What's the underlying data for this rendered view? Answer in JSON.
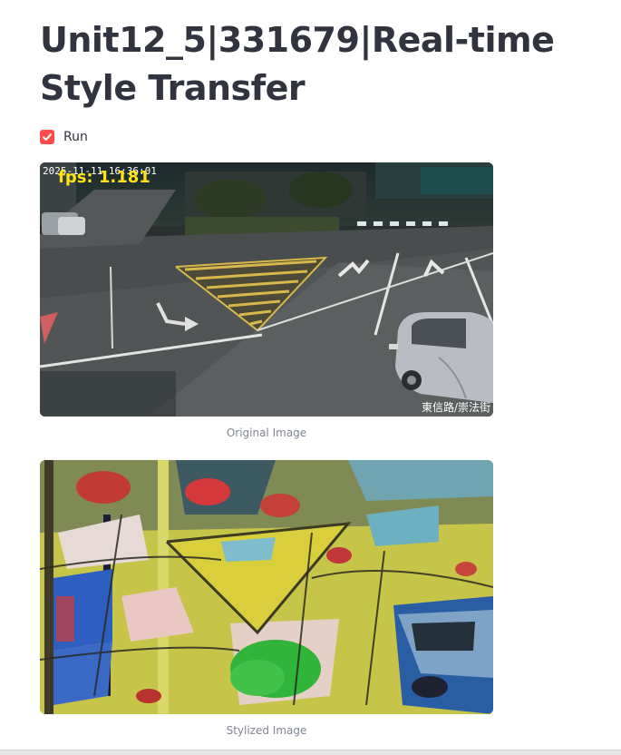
{
  "app": {
    "title": "Unit12_5|331679|Real-time Style Transfer"
  },
  "controls": {
    "run_label": "Run",
    "run_checked": true
  },
  "original_image": {
    "timestamp_overlay": "2025-11-11 16:36:01",
    "fps_overlay": "fps: 1.181",
    "location_overlay": "東信路/崇法街",
    "caption": "Original Image"
  },
  "stylized_image": {
    "caption": "Stylized Image"
  },
  "colors": {
    "accent": "#ff4b4b",
    "text": "#31333f",
    "caption": "#808495"
  }
}
